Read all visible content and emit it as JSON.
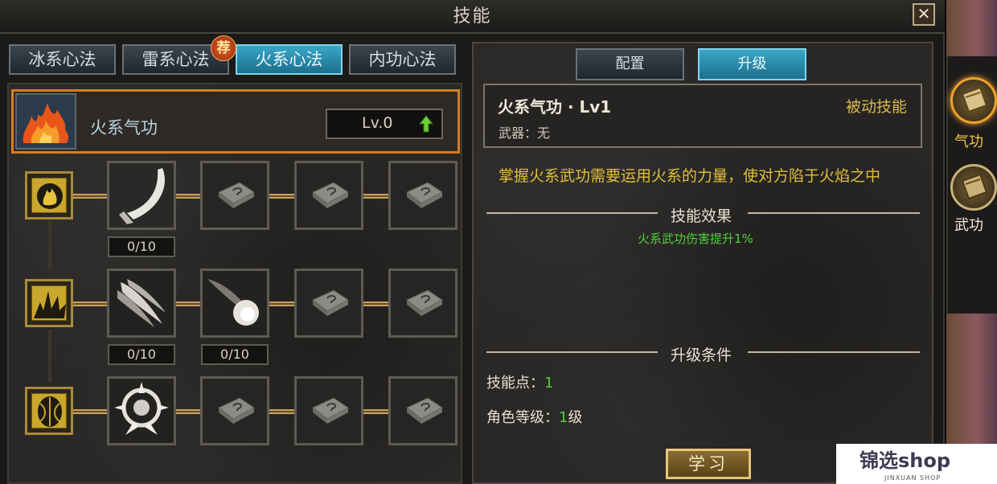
{
  "window": {
    "title": "技能",
    "close_glyph": "✕"
  },
  "left_tabs": [
    {
      "label": "冰系心法",
      "active": false
    },
    {
      "label": "雷系心法",
      "active": false,
      "badge": "荐"
    },
    {
      "label": "火系心法",
      "active": true
    },
    {
      "label": "内功心法",
      "active": false
    }
  ],
  "selected_skill": {
    "name": "火系气功",
    "level": "Lv.0",
    "icon": "fire-icon"
  },
  "skill_tree": {
    "rows": [
      {
        "category_icon": "flame-emblem-icon",
        "slots": [
          "curved-blade-skill-icon",
          "locked-book-icon",
          "locked-book-icon",
          "locked-book-icon"
        ],
        "counters": [
          "0/10"
        ]
      },
      {
        "category_icon": "spike-emblem-icon",
        "slots": [
          "fire-claw-skill-icon",
          "comet-skill-icon",
          "locked-book-icon",
          "locked-book-icon"
        ],
        "counters": [
          "0/10",
          "0/10"
        ]
      },
      {
        "category_icon": "shield-emblem-icon",
        "slots": [
          "burst-rune-skill-icon",
          "locked-book-icon",
          "locked-book-icon",
          "locked-book-icon"
        ],
        "counters": []
      }
    ]
  },
  "right_tabs": [
    {
      "label": "配置",
      "active": false
    },
    {
      "label": "升级",
      "active": true
    }
  ],
  "detail": {
    "title": "火系气功 · Lv1",
    "type": "被动技能",
    "weapon_label": "武器：",
    "weapon_value": "无",
    "description": "掌握火系武功需要运用火系的力量，使对方陷于火焰之中",
    "effect_header": "技能效果",
    "effect_text": "火系武功伤害提升1%",
    "requirements_header": "升级条件",
    "requirements": [
      {
        "label": "技能点：",
        "value": "1",
        "suffix": ""
      },
      {
        "label": "角色等级：",
        "value": "1",
        "suffix": "级"
      }
    ],
    "learn_button": "学习"
  },
  "side_tabs": [
    {
      "label": "气功",
      "active": true
    },
    {
      "label": "武功",
      "active": false
    }
  ],
  "watermark": {
    "name": "锦选shop",
    "sub": "JINXUAN SHOP"
  },
  "colors": {
    "accent_blue": "#39a7c7",
    "highlight_orange": "#d57d24",
    "effect_green": "#4fd03b",
    "desc_gold": "#e0bf3c"
  }
}
